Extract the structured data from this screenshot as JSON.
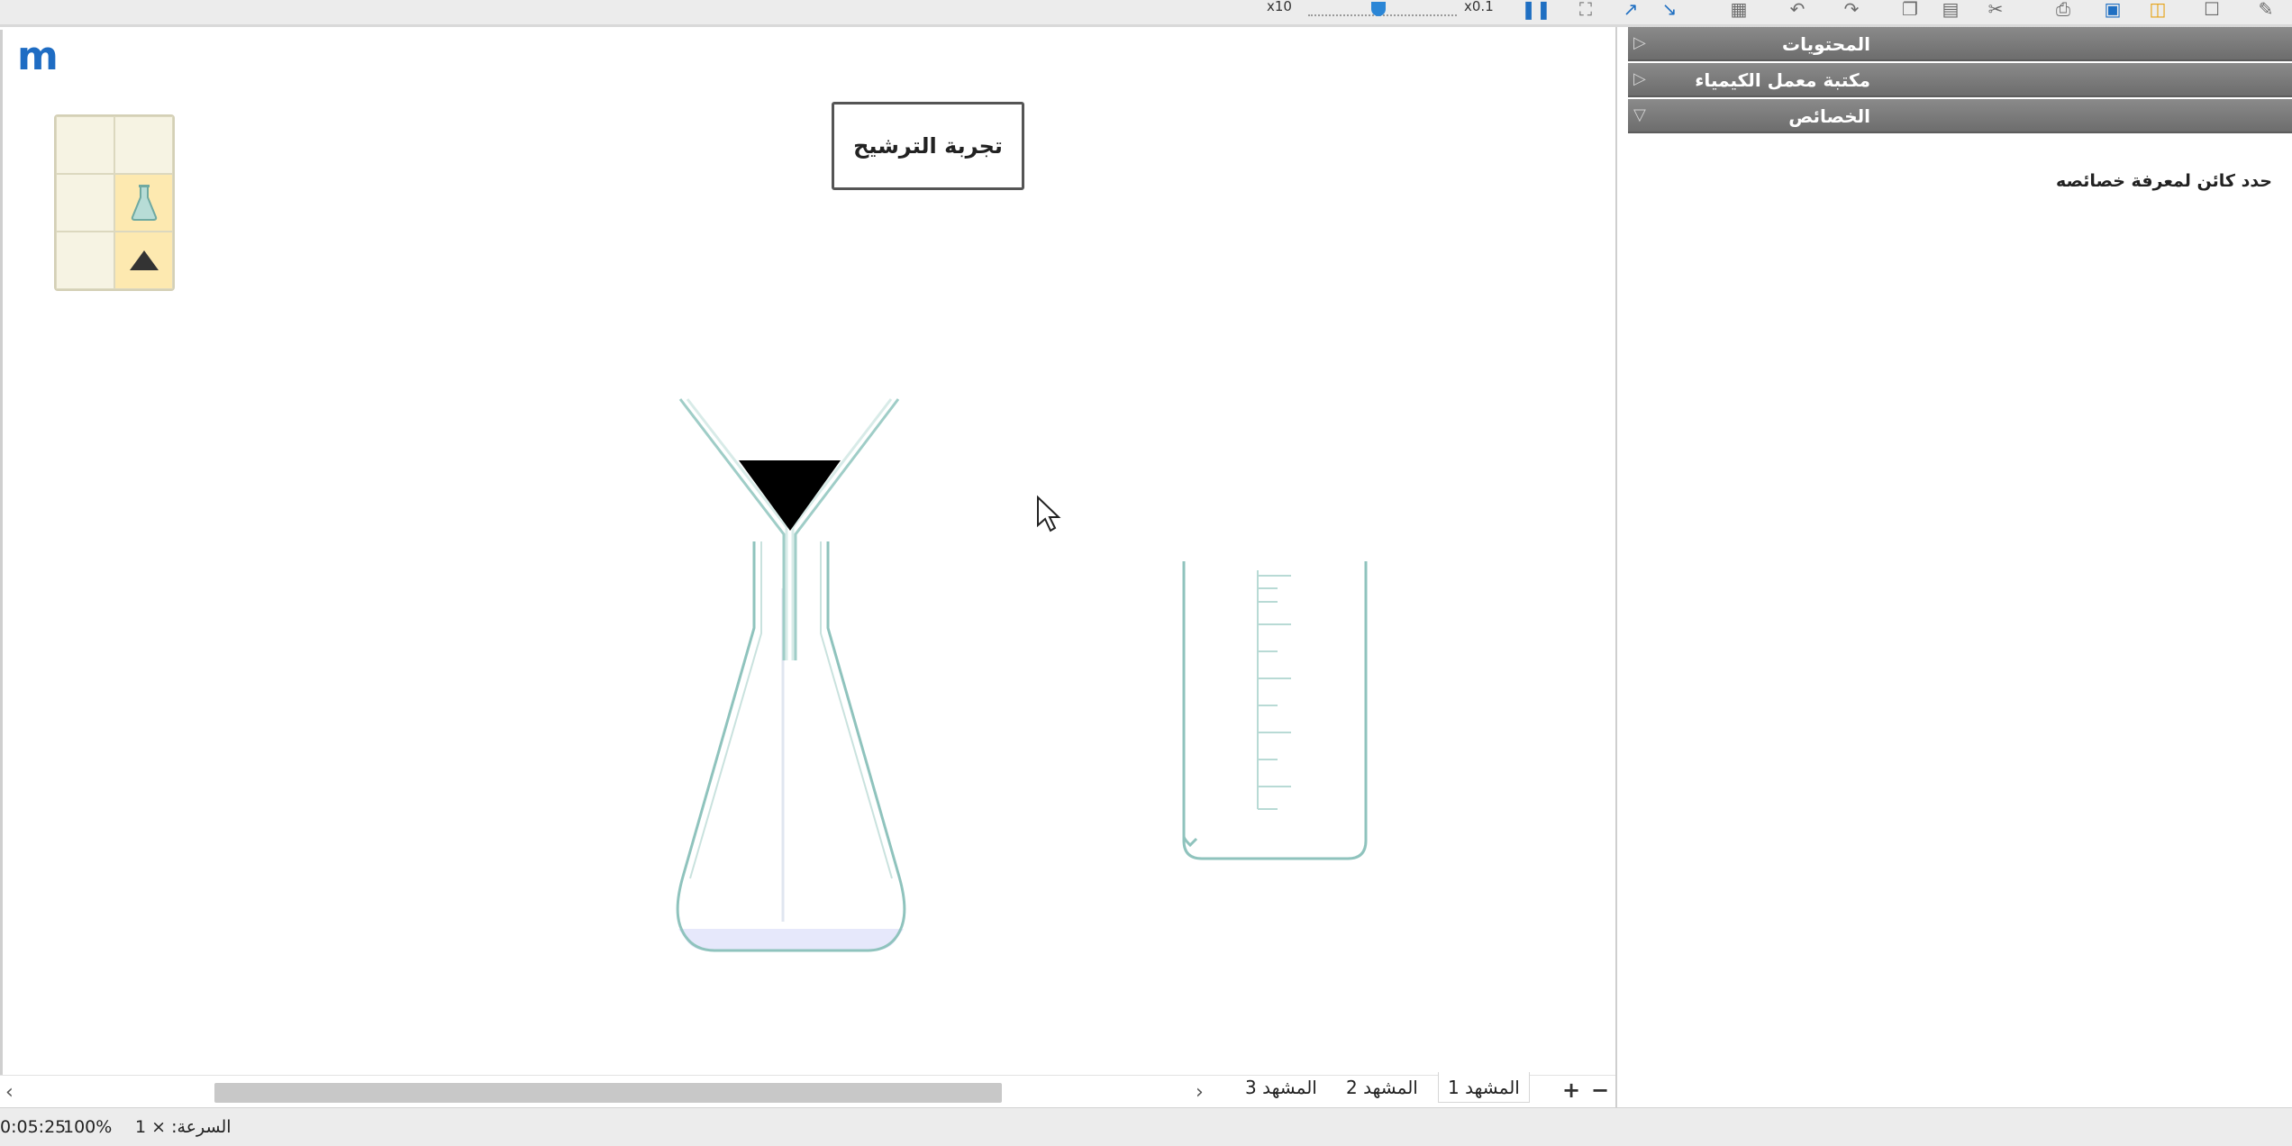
{
  "toolbar": {
    "speed_min_label": "x10",
    "speed_max_label": "x0.1",
    "icons": [
      "pause-icon",
      "zoom-fit-icon",
      "zoom-in-icon",
      "zoom-out-icon",
      "grid-icon",
      "undo-icon",
      "redo-icon",
      "copy-icon",
      "paste-icon",
      "cut-icon",
      "print-icon",
      "save-icon",
      "open-folder-icon",
      "new-file-icon",
      "help-icon"
    ]
  },
  "canvas": {
    "logo": "m",
    "title": "تجربة الترشيح"
  },
  "scenes": {
    "tabs": [
      {
        "label": "المشهد 3",
        "active": false
      },
      {
        "label": "المشهد 2",
        "active": false
      },
      {
        "label": "المشهد 1",
        "active": true
      }
    ],
    "add": "+",
    "remove": "−"
  },
  "status": {
    "time": "0:05:25",
    "zoom": "100%",
    "speed": "السرعة: × 1"
  },
  "panel": {
    "sections": [
      {
        "label": "المحتويات",
        "expanded": false
      },
      {
        "label": "مكتبة معمل الكيمياء",
        "expanded": false
      },
      {
        "label": "الخصائص",
        "expanded": true
      }
    ],
    "properties_hint": "حدد كائن لمعرفة خصائصه"
  },
  "colors": {
    "glass": "#8fc3bd",
    "solid": "#000000",
    "liquid": "#e6e8fb",
    "accent": "#1e6cc3",
    "panel_header": "#767676"
  }
}
